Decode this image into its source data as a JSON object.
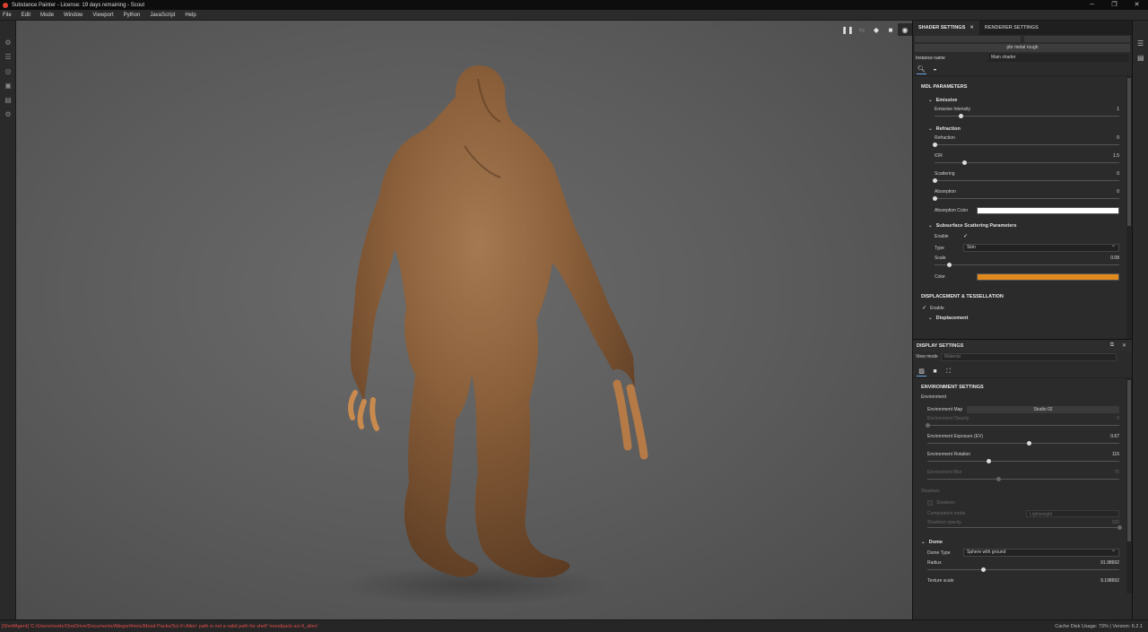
{
  "window": {
    "title": "Substance Painter - License: 19 days remaining - Scout",
    "minimize": "─",
    "maximize": "❐",
    "close": "✕"
  },
  "menu": [
    "File",
    "Edit",
    "Mode",
    "Window",
    "Viewport",
    "Python",
    "JavaScript",
    "Help"
  ],
  "shader_panel": {
    "tab_active": "SHADER SETTINGS",
    "tab_other": "RENDERER SETTINGS",
    "mdl_button": "pbr metal rough",
    "instance_label": "Instance name",
    "instance_value": "Main shader",
    "section_title": "MDL PARAMETERS",
    "emissive": {
      "title": "Emissive",
      "intensity_label": "Emissive Intensity",
      "intensity_value": "1",
      "intensity_fraction": 0.14
    },
    "refraction": {
      "title": "Refraction",
      "refraction_label": "Refraction",
      "refraction_value": "0",
      "refraction_fraction": 0,
      "ior_label": "IOR",
      "ior_value": "1.5",
      "ior_fraction": 0.16,
      "scattering_label": "Scattering",
      "scattering_value": "0",
      "scattering_fraction": 0,
      "absorption_label": "Absorption",
      "absorption_value": "0",
      "absorption_fraction": 0,
      "absorption_color_label": "Absorption Color",
      "absorption_color": "#ffffff"
    },
    "sss": {
      "title": "Subsurface Scattering Parameters",
      "enable_label": "Enable",
      "enable_check": "✓",
      "type_label": "Type",
      "type_value": "Skin",
      "scale_label": "Scale",
      "scale_value": "0.08",
      "scale_fraction": 0.08,
      "color_label": "Color",
      "color": "#e08a1e"
    },
    "displacement": {
      "title": "DISPLACEMENT & TESSELLATION",
      "enable_check": "✓",
      "enable_label": "Enable",
      "sub_title": "Displacement"
    }
  },
  "display_panel": {
    "title": "DISPLAY SETTINGS",
    "view_mode_label": "View mode",
    "view_mode_value": "Material",
    "section_title": "ENVIRONMENT SETTINGS",
    "environment_group": "Environment",
    "env_map_label": "Environment Map",
    "env_map_value": "Studio 02",
    "env_opacity_label": "Environment Opacity",
    "env_opacity_value": "0",
    "env_opacity_fraction": 0,
    "env_exposure_label": "Environment Exposure (EV)",
    "env_exposure_value": "0.67",
    "env_exposure_fraction": 0.53,
    "env_rotation_label": "Environment Rotation",
    "env_rotation_value": "116",
    "env_rotation_fraction": 0.32,
    "env_blur_label": "Environment Blur",
    "env_blur_value": "70",
    "env_blur_fraction": 0.37,
    "shadows_group": "Shadows",
    "shadows_label": "Shadows",
    "computation_label": "Computation mode",
    "computation_value": "Lightweight",
    "shadows_opacity_label": "Shadows opacity",
    "shadows_opacity_value": "100",
    "shadows_opacity_fraction": 1.0,
    "dome_title": "Dome",
    "dome_type_label": "Dome Type",
    "dome_type_value": "Sphere with ground",
    "radius_label": "Radius",
    "radius_value": "91.98692",
    "radius_fraction": 0.29,
    "texture_scale_label": "Texture scale",
    "texture_scale_value": "9.198692"
  },
  "status": {
    "error": "[ShelfAgent] 'C:/Users/nordc/OneDrive/Documents/Allegorithmic/Mood Packs/Sci-Fi Alien' path is not a valid path for shelf 'moodpack-sci-fi_alien'",
    "cache": "Cache Disk Usage:  73% | Version: 6.2.1"
  }
}
